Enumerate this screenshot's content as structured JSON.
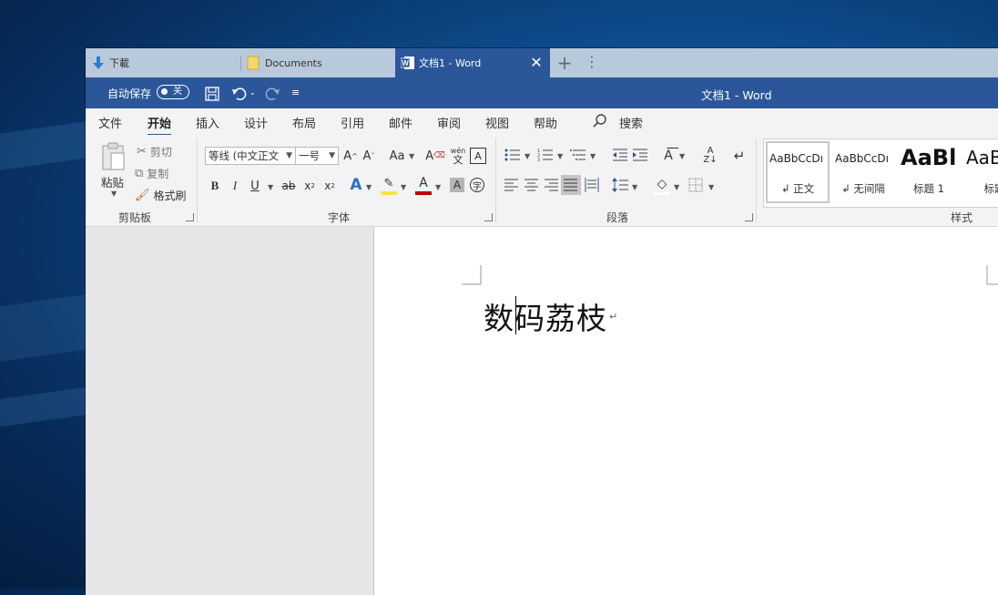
{
  "tabs": [
    {
      "label": "下載",
      "icon": "download-arrow-icon"
    },
    {
      "label": "Documents",
      "icon": "folder-icon"
    },
    {
      "label": "文档1 - Word",
      "icon": "word-icon",
      "active": true
    }
  ],
  "titlebar": {
    "autosave_label": "自动保存",
    "autosave_state": "关",
    "doc_title": "文档1  -  Word"
  },
  "ribbon_tabs": [
    "文件",
    "开始",
    "插入",
    "设计",
    "布局",
    "引用",
    "邮件",
    "审阅",
    "视图",
    "帮助"
  ],
  "search_label": "搜索",
  "clipboard": {
    "paste": "粘贴",
    "cut": "剪切",
    "copy": "复制",
    "format_painter": "格式刷",
    "group_label": "剪贴板"
  },
  "font": {
    "font_name": "等线 (中文正文",
    "font_size": "一号",
    "case_label": "Aa",
    "pinyin_top": "wén",
    "pinyin_char": "文",
    "group_label": "字体"
  },
  "paragraph": {
    "group_label": "段落"
  },
  "styles": {
    "group_label": "样式",
    "items": [
      {
        "sample": "AaBbCcDı",
        "name": "正文"
      },
      {
        "sample": "AaBbCcDı",
        "name": "无间隔"
      },
      {
        "sample": "AaBl",
        "name": "标题 1"
      },
      {
        "sample": "AaB",
        "name": "标题"
      }
    ]
  },
  "document": {
    "text": "数码荔枝"
  },
  "colors": {
    "accent": "#2b579a",
    "tabbar": "#b9c9dc",
    "ribbon": "#f3f3f3",
    "highlight": "#ffe14a",
    "font_color": "#c00000"
  }
}
